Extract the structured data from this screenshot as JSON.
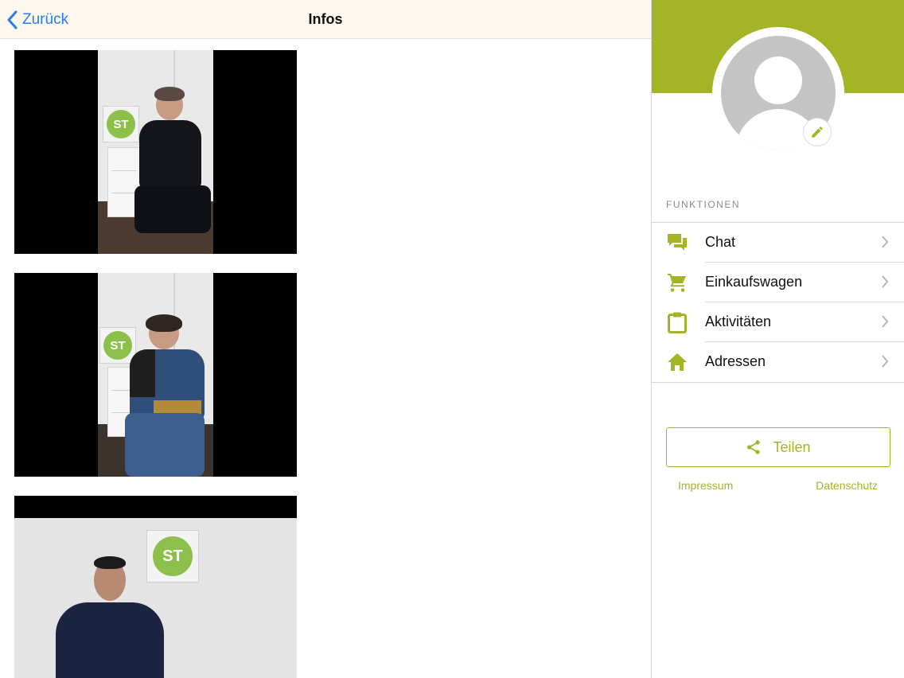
{
  "nav": {
    "back_label": "Zurück",
    "title": "Infos"
  },
  "videos": [
    {
      "logo_text": "ST"
    },
    {
      "logo_text": "ST"
    },
    {
      "logo_text": "ST"
    }
  ],
  "sidebar": {
    "section_label": "FUNKTIONEN",
    "items": [
      {
        "label": "Chat",
        "icon": "chat-icon"
      },
      {
        "label": "Einkaufswagen",
        "icon": "cart-icon"
      },
      {
        "label": "Aktivitäten",
        "icon": "clipboard-icon"
      },
      {
        "label": "Adressen",
        "icon": "home-icon"
      }
    ],
    "share_label": "Teilen",
    "links": {
      "impressum": "Impressum",
      "datenschutz": "Datenschutz"
    }
  },
  "colors": {
    "accent": "#a3b427",
    "link_blue": "#2b7de9",
    "navbar_bg": "#fcf7ef"
  }
}
